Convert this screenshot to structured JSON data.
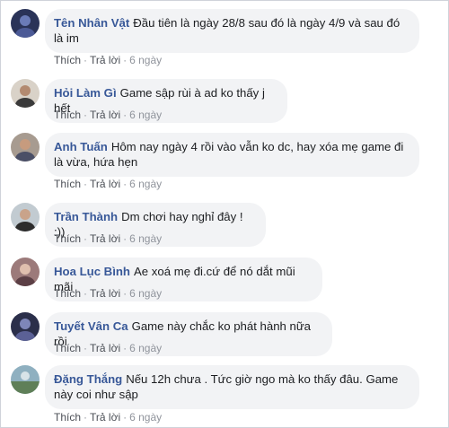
{
  "comments": [
    {
      "author": "Tên Nhân Vật",
      "text": "Đầu tiên là ngày 28/8 sau đó là ngày 4/9 và sau đó là im",
      "like": "Thích",
      "reply": "Trả lời",
      "time": "6 ngày",
      "avatar_color": "#2a3358"
    },
    {
      "author": "Hỏi Làm Gì",
      "text": "Game sập rùi à ad ko thấy j hết",
      "like": "Thích",
      "reply": "Trả lời",
      "time": "6 ngày",
      "avatar_color": "#c8b9a8"
    },
    {
      "author": "Anh Tuấn",
      "text": "Hôm nay ngày 4 rồi vào vẫn ko dc, hay xóa mẹ game đi là vừa, hứa hẹn",
      "like": "Thích",
      "reply": "Trả lời",
      "time": "6 ngày",
      "avatar_color": "#9a8f86"
    },
    {
      "author": "Trần Thành",
      "text": "Dm chơi hay nghỉ đây ! :))",
      "like": "Thích",
      "reply": "Trả lời",
      "time": "6 ngày",
      "avatar_color": "#b8c2c8"
    },
    {
      "author": "Hoa Lục Bình",
      "text": "Ae xoá mẹ đi.cứ để nó dắt mũi mãi",
      "like": "Thích",
      "reply": "Trả lời",
      "time": "6 ngày",
      "avatar_color": "#8b6b6b"
    },
    {
      "author": "Tuyết Vân Ca",
      "text": "Game này chắc ko phát hành nữa rồi",
      "like": "Thích",
      "reply": "Trả lời",
      "time": "6 ngày",
      "avatar_color": "#2b2f4a"
    },
    {
      "author": "Đặng Thắng",
      "text": "Nếu 12h chưa . Tức giờ ngo mà ko thấy đâu. Game này coi như sập",
      "like": "Thích",
      "reply": "Trả lời",
      "time": "6 ngày",
      "avatar_color": "#6f8f9e"
    }
  ]
}
